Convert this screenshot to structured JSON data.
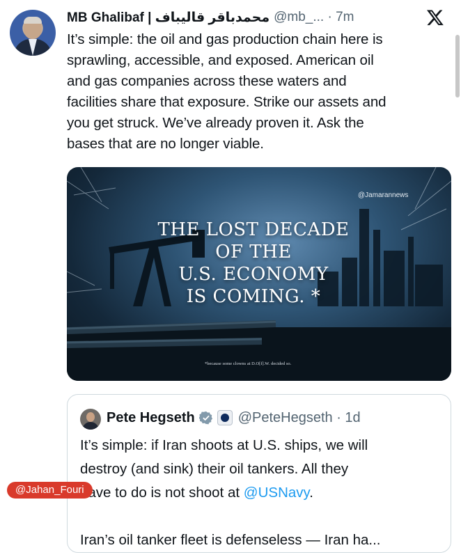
{
  "tweet": {
    "display_name": "MB Ghalibaf | محمدباقر قالیباف",
    "handle": "@mb_... · 7m",
    "lines": [
      "It’s simple: the oil and gas production chain here is",
      "sprawling, accessible, and exposed. American oil",
      "and gas companies across these waters and",
      "facilities share that exposure. Strike our assets and",
      "you get struck. We’ve already proven it. Ask the",
      "bases that are no longer viable."
    ],
    "avatar_icon": "user-avatar",
    "platform_icon": "x-logo-icon"
  },
  "media": {
    "headline_lines": [
      "THE LOST DECADE",
      "OF THE",
      "U.S. ECONOMY",
      "IS COMING. *"
    ],
    "watermark": "@Jamarannews",
    "footnote": "*because some clowns at D.O[f].W. decided so."
  },
  "quote": {
    "display_name": "Pete Hegseth",
    "handle": "@PeteHegseth · 1d",
    "line1": "It’s simple: if Iran shoots at U.S. ships, we will",
    "line2": "destroy (and sink) their oil tankers. All they",
    "line3_pre": "have to do is not shoot at ",
    "line3_mention": "@USNavy",
    "line3_post": ".",
    "line4": "Iran’s oil tanker fleet is defenseless — Iran ha...",
    "verified_icon": "verified-badge-icon",
    "affiliate_icon": "department-seal-icon"
  },
  "overlay": {
    "channel_tag": "@Jahan_Fouri"
  },
  "colors": {
    "text": "#0f1419",
    "muted": "#536471",
    "link": "#1d9bf0",
    "border": "#cfd9de",
    "tag": "#d93a2b"
  }
}
